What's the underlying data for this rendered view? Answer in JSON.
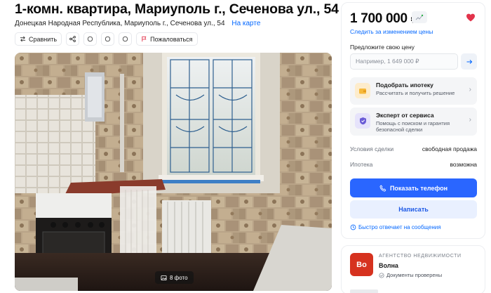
{
  "listing": {
    "title": "1-комн. квартира, Мариуполь г., Сеченова ул., 54",
    "address": "Донецкая Народная Республика, Мариуполь г., Сеченова ул., 54",
    "map_link": "На карте"
  },
  "actions": {
    "compare": "Сравнить",
    "report": "Пожаловаться"
  },
  "photo": {
    "count_label": "8 фото"
  },
  "sidebar": {
    "price": "1 700 000 ₽",
    "follow_price": "Следить за изменением цены",
    "offer_label": "Предложите свою цену",
    "offer_placeholder": "Например, 1 649 000 ₽",
    "promo_mortgage": {
      "title": "Подобрать ипотеку",
      "subtitle": "Рассчитать и получить решение"
    },
    "promo_expert": {
      "title": "Эксперт от сервиса",
      "subtitle": "Помощь с поиском и гарантия безопасной сделки"
    },
    "deal_conditions": {
      "key": "Условия сделки",
      "value": "свободная продажа"
    },
    "mortgage": {
      "key": "Ипотека",
      "value": "возможна"
    },
    "show_phone": "Показать телефон",
    "write": "Написать",
    "fast_reply": "Быстро отвечает на сообщения"
  },
  "agency": {
    "type": "АГЕНТСТВО НЕДВИЖИМОСТИ",
    "logo_text": "Во",
    "name": "Волна",
    "verified": "Документы проверены"
  },
  "colors": {
    "accent": "#2a66ff",
    "link": "#0468ff",
    "heart": "#e2334b",
    "agency_logo": "#d6321f"
  }
}
